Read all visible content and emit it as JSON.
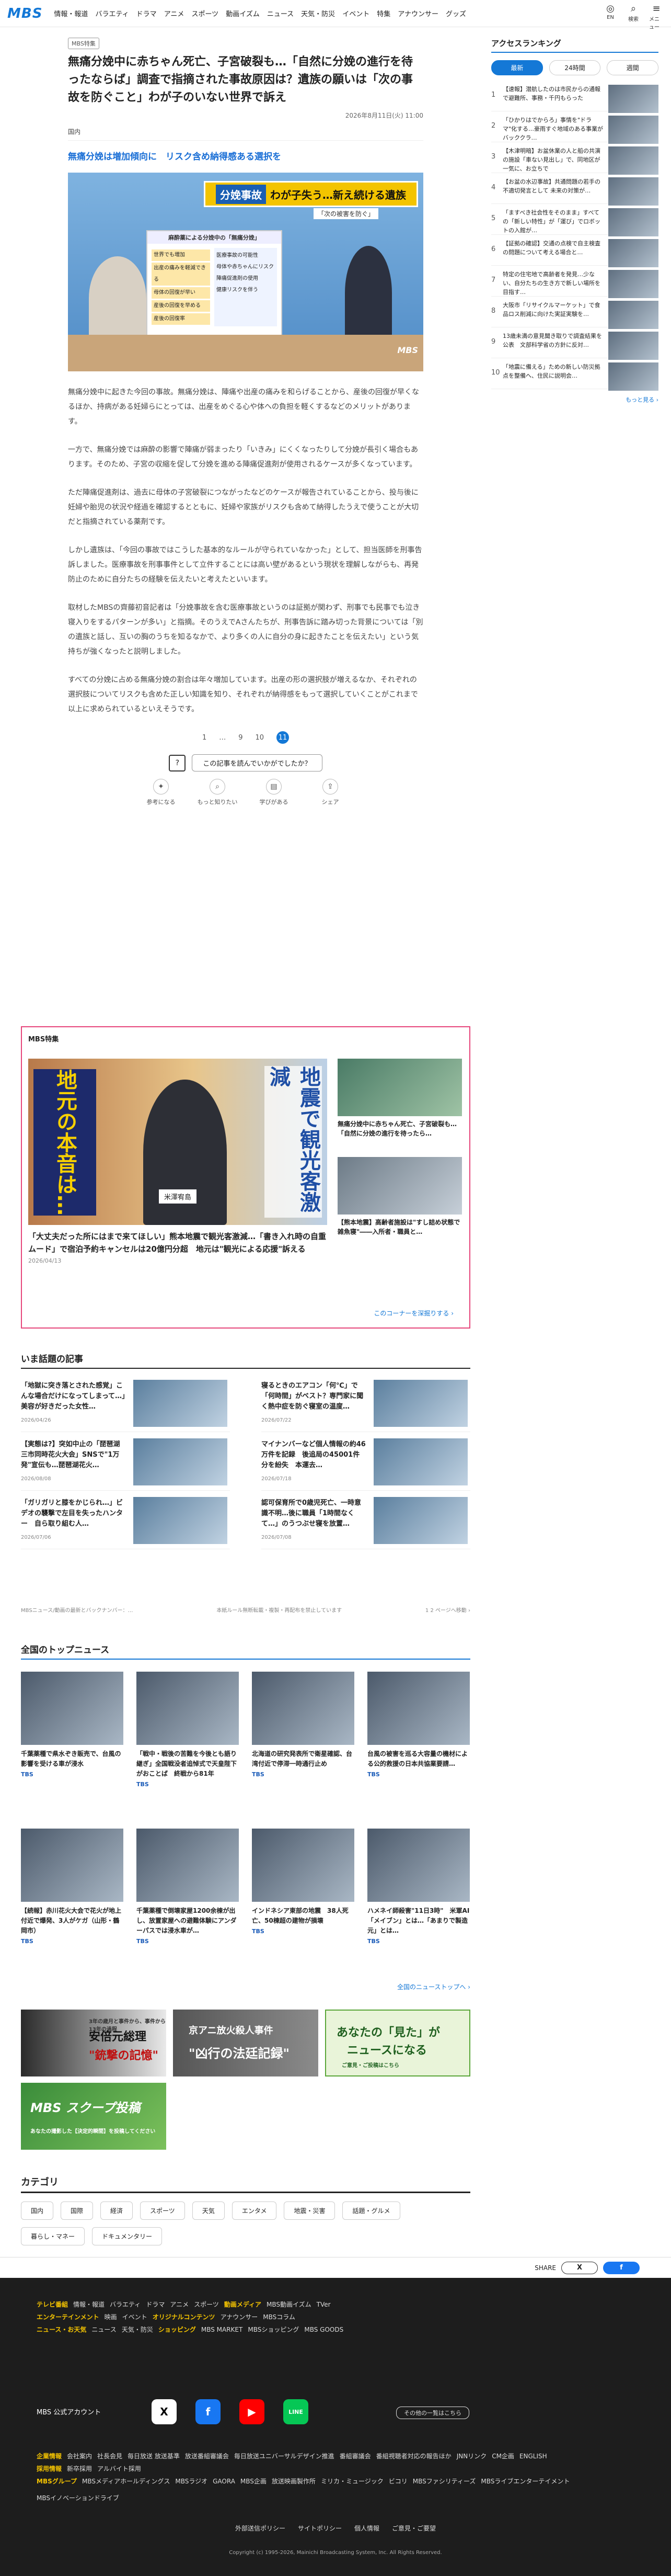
{
  "header": {
    "logo": "MBS",
    "nav": [
      "情報・報道",
      "バラエティ",
      "ドラマ",
      "アニメ",
      "スポーツ",
      "動画イズム",
      "ニュース",
      "天気・防災",
      "イベント",
      "特集",
      "アナウンサー",
      "グッズ"
    ],
    "icons": [
      {
        "label": "EN",
        "icon": "globe-icon"
      },
      {
        "label": "検索",
        "icon": "search-icon"
      },
      {
        "label": "メニュー",
        "icon": "menu-icon"
      }
    ]
  },
  "article": {
    "tag": "MBS特集",
    "title": "無痛分娩中に赤ちゃん死亡、子宮破裂も…「自然に分娩の進行を待ったならば」調査で指摘された事故原因は？遺族の願いは「次の事故を防ぐこと」わが子のいない世界で訴え",
    "date": "2026年8月11日(火) 11:00",
    "category": "国内",
    "subtitle": "無痛分娩は増加傾向に　リスク含め納得感ある選択を",
    "photo": {
      "banner_left": "分娩事故",
      "banner_right": "わが子失う…新え続ける遺族",
      "caption_tag": "「次の被害を防ぐ」",
      "board_head": "麻酔薬による分娩中の「無痛分娩」",
      "board_items": [
        "世界でも増加",
        "出産の痛みを軽減できる",
        "母体の回復が早い",
        "産後の回復を早める",
        "産後の回復率"
      ],
      "board_right": [
        "医療事故の可能性",
        "母体や赤ちゃんにリスク",
        "陣痛促進剤の使用",
        "健康リスクを伴う"
      ],
      "corner": "MBS"
    },
    "paragraphs": [
      "無痛分娩中に起きた今回の事故。無痛分娩は、陣痛や出産の痛みを和らげることから、産後の回復が早くなるほか、持病がある妊婦らにとっては、出産をめぐる心や体への負担を軽くするなどのメリットがあります。",
      "一方で、無痛分娩では麻酔の影響で陣痛が弱まったり「いきみ」にくくなったりして分娩が長引く場合もあります。そのため、子宮の収縮を促して分娩を進める陣痛促進剤が使用されるケースが多くなっています。",
      "ただ陣痛促進剤は、過去に母体の子宮破裂につながったなどのケースが報告されていることから、投与後に妊婦や胎児の状況や経過を確認するとともに、妊婦や家族がリスクも含めて納得したうえで使うことが大切だと指摘されている薬剤です。",
      "しかし遺族は、「今回の事故ではこうした基本的なルールが守られていなかった」として、担当医師を刑事告訴しました。医療事故を刑事事件として立件することには高い壁があるという現状を理解しながらも、再発防止のために自分たちの経験を伝えたいと考えたといいます。",
      "取材したMBSの齊藤初音記者は「分娩事故を含む医療事故というのは証拠が関わず、刑事でも民事でも泣き寝入りをするパターンが多い」と指摘。そのうえでAさんたちが、刑事告訴に踏み切った背景については「別の遺族と話し、互いの胸のうちを知るなかで、より多くの人に自分の身に起きたことを伝えたい」という気持ちが強くなったと説明しました。",
      "すべての分娩に占める無痛分娩の割合は年々増加しています。出産の形の選択肢が増えるなか、それぞれの選択肢についてリスクも含めた正しい知識を知り、それぞれが納得感をもって選択していくことがこれまで以上に求められているといえそうです。"
    ],
    "pager": [
      "1",
      "…",
      "9",
      "10",
      "11"
    ],
    "pager_current": "11",
    "question": "この記事を読んでいかがでしたか？",
    "reactions": [
      {
        "label": "参考になる",
        "icon": "lightbulb-icon"
      },
      {
        "label": "もっと知りたい",
        "icon": "magnifier-icon"
      },
      {
        "label": "学びがある",
        "icon": "book-icon"
      },
      {
        "label": "シェア",
        "icon": "share-icon"
      }
    ]
  },
  "special": {
    "heading": "MBS特集",
    "main_caption": "「大丈夫だった所にはまで来てほしい」熊本地震で観光客激減…「書き入れ時の自重ムード」で宿泊予約キャンセルは20億円分超　地元は\"観光による応援\"訴える",
    "main_date": "2026/04/13",
    "main_overlay_left": "地元の本音は…",
    "main_overlay_right": "地震で観光客激減",
    "main_name": "米澤宥島",
    "side": [
      {
        "title": "無痛分娩中に赤ちゃん死亡、子宮破裂も…「自然に分娩の進行を待ったら…"
      },
      {
        "title": "【熊本地震】高齢者施設は\"すし詰め状態で雑魚寝\"――入所者・職員と…"
      }
    ],
    "link": "このコーナーを深掘りする ›"
  },
  "trending": {
    "heading": "いま話題の記事",
    "items": [
      {
        "title": "「地獄に突き落とされた感覚」こんな場合だけになってしまって…」美容が好きだった女性…",
        "date": "2026/04/26"
      },
      {
        "title": "寝るときのエアコン「何℃」で「何時間」がベスト？専門家に聞く熱中症を防ぐ寝室の温度…",
        "date": "2026/07/22"
      },
      {
        "title": "【実態は?】突如中止の「琵琶湖三市同時花火大会」SNSで\"1万発\"宣伝も…琵琶湖花火…",
        "date": "2026/08/08"
      },
      {
        "title": "マイナンバーなど個人情報の約46万件を記録　後追局の45001件分を紛失　本運去…",
        "date": "2026/07/18"
      },
      {
        "title": "「ガリガリと膝をかじられ…」ビデオの襲撃で左目を失ったハンター　自ら取り組む人…",
        "date": "2026/07/06"
      },
      {
        "title": "認可保育所で0歳児死亡、一時意識不明…後に職員「1時間なくて…」のうつぶせ寝を放置…",
        "date": "2026/07/08"
      }
    ],
    "note_left": "MBSニュース/動画の最新とバックナンバー：…",
    "note_mid": "本紙ルール無断転載・複製・再配布を禁止しています",
    "note_right": "1 2 ページへ移動 ›"
  },
  "top_news": {
    "heading": "全国のトップニュース",
    "items": [
      {
        "title": "千葉薬種で県水ぞき販売で、台風の影響を受ける車が浸水",
        "source": "TBS"
      },
      {
        "title": "「戦中・戦後の苦難を今後とも語り継ぎ」全国戦没者追悼式で天皇陛下がおことば　終戦から81年",
        "source": "TBS"
      },
      {
        "title": "北海道の研究発表所で衛星確認、台湾付近で停滞一時通行止め",
        "source": "TBS"
      },
      {
        "title": "台風の被害を巡る大容量の機材による公的救援の日本共協業要請…",
        "source": "TBS"
      },
      {
        "title": "【続報】赤川花火大会で花火が地上付近で爆発、3人がケガ（山形・鶴岡市）",
        "source": "TBS"
      },
      {
        "title": "千葉薬種で倒壊家屋1200余棟が出し、放置家屋への避難体験にアンダーパスでは浸水車が…",
        "source": "TBS"
      },
      {
        "title": "インドネシア東部の地震　38人死亡、50棟超の建物が損壊",
        "source": "TBS"
      },
      {
        "title": "ハメネイ師殺害\"11日3時\"　米軍AI「メイブン」とは…「あまりで製造元」とは…",
        "source": "TBS"
      }
    ],
    "link": "全国のニューストップへ ›"
  },
  "banners": [
    {
      "a": "安倍元総理",
      "b": "\"銃撃の記憶\"",
      "c": "3年の歳月と事件から、事件から13年の過程"
    },
    {
      "a": "京アニ放火殺人事件",
      "b": "\"凶行の法廷記録\"",
      "c": ""
    },
    {
      "a": "あなたの「見た」が",
      "b": "ニュースになる",
      "c": "ご意見・ご投稿はこちら"
    },
    {
      "a": "MBS スクープ投稿",
      "b": "あなたの撮影した【決定的瞬間】を投稿してください",
      "c": ""
    }
  ],
  "categories": {
    "heading": "カテゴリ",
    "items": [
      "国内",
      "国際",
      "経済",
      "スポーツ",
      "天気",
      "エンタメ",
      "地震・災害",
      "話題・グルメ",
      "暮らし・マネー",
      "ドキュメンタリー"
    ]
  },
  "share": {
    "label": "SHARE",
    "x": "X",
    "facebook": "f"
  },
  "footer": {
    "rows": [
      {
        "lbl": "テレビ番組",
        "items": [
          "情報・報道",
          "バラエティ",
          "ドラマ",
          "アニメ",
          "スポーツ"
        ],
        "lbl2": "動画メディア",
        "items2": [
          "MBS動画イズム",
          "TVer"
        ]
      },
      {
        "lbl": "エンターテインメント",
        "items": [
          "映画",
          "イベント"
        ],
        "lbl2": "オリジナルコンテンツ",
        "items2": [
          "アナウンサー",
          "MBSコラム"
        ]
      },
      {
        "lbl": "ニュース・お天気",
        "items": [
          "ニュース",
          "天気・防災"
        ],
        "lbl2": "ショッピング",
        "items2": [
          "MBS MARKET",
          "MBSショッピング",
          "MBS GOODS"
        ]
      }
    ],
    "account_label": "MBS 公式アカウント",
    "social": [
      "X",
      "f",
      "▶",
      "LINE"
    ],
    "social_more": "その他の一覧はこちら",
    "info": [
      "会社案内",
      "社長会見",
      "毎日放送 放送基準",
      "放送番組審議会",
      "毎日放送ユニバーサルデザイン推進",
      "番組審議会",
      "番組視聴者対応の報告ほか",
      "JNNリンク",
      "CM企画",
      "ENGLISH"
    ],
    "info_lbl": "企業情報",
    "recruit_lbl": "採用情報",
    "recruit": [
      "新卒採用",
      "アルバイト採用"
    ],
    "group_lbl": "MBSグループ",
    "group": [
      "MBSメディアホールディングス",
      "MBSラジオ",
      "GAORA",
      "MBS企画",
      "放送映画製作所",
      "ミリカ・ミュージック",
      "ビコリ",
      "MBSファシリティーズ",
      "MBSライブエンターテイメント",
      "MBSイノベーションドライブ"
    ],
    "bottom": [
      "外部送信ポリシー",
      "サイトポリシー",
      "個人情報",
      "ご意見・ご要望"
    ],
    "copyright": "Copyright (c) 1995-2026, Mainichi Broadcasting System, Inc. All Rights Reserved."
  },
  "ranking": {
    "heading": "アクセスランキング",
    "tabs": [
      "最新",
      "24時間",
      "週間"
    ],
    "items": [
      {
        "n": "1",
        "t": "【速報】潜航したのは市民からの通報で避難所、事務・千円もらった"
      },
      {
        "n": "2",
        "t": "「ひかりはでからろ」事情を\"ドラマ\"化する…豪雨すぐ地域のある事業がバッククラ…"
      },
      {
        "n": "3",
        "t": "【木津明暗】お盆休業の人と船の共演の施設「車ない見出し」で、同地区が一気に、お立ちで"
      },
      {
        "n": "4",
        "t": "【お盆の水辺事故】共通問題の若手の不適切発言として 未来の対策が…"
      },
      {
        "n": "5",
        "t": "「ますべき社会性をそのまま」すべての「新しい特性」が「運び」でロボットの入館が…"
      },
      {
        "n": "6",
        "t": "【証拠の確認】交通の点検で自主検査の問題について考える場合と…"
      },
      {
        "n": "7",
        "t": "特定の住宅地で高齢者を発見…少ない、自分たちの生き方で新しい場所を目指す…"
      },
      {
        "n": "8",
        "t": "大阪市「リサイクルマーケット」で食品ロス削減に向けた実証実験を…"
      },
      {
        "n": "9",
        "t": "13歳未満の意見聞き取りで調査結果を公表　文部科学省の方針に反対…"
      },
      {
        "n": "10",
        "t": "「地震に備える」ための新しい防災拠点を整備へ、住民に説明会…"
      }
    ],
    "more": "もっと見る ›"
  }
}
